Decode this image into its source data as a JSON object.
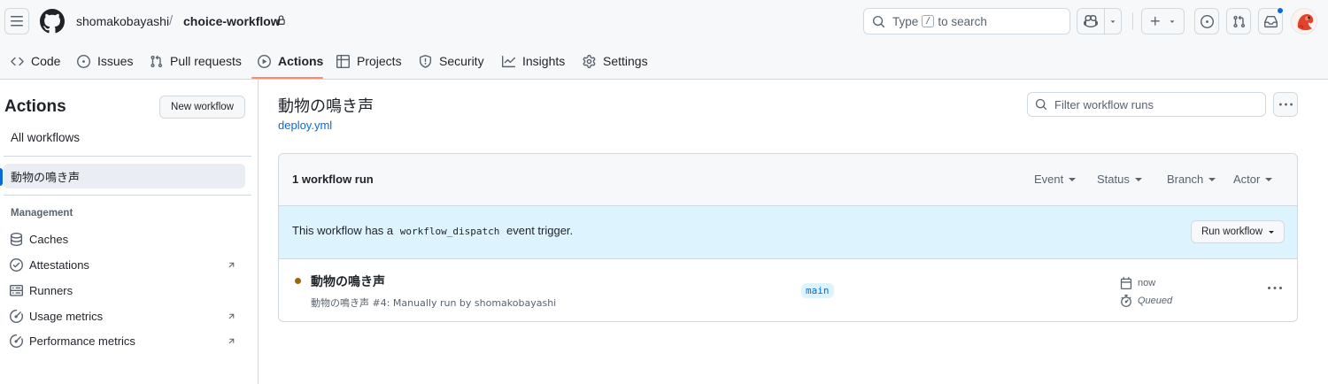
{
  "header": {
    "owner": "shomakobayashi",
    "separator": "/",
    "repo": "choice-workflow",
    "search": {
      "prefix": "Type",
      "key": "/",
      "suffix": "to search"
    }
  },
  "tabs": [
    {
      "label": "Code",
      "icon": "code-icon"
    },
    {
      "label": "Issues",
      "icon": "issue-opened-icon"
    },
    {
      "label": "Pull requests",
      "icon": "git-pull-request-icon"
    },
    {
      "label": "Actions",
      "icon": "play-icon",
      "active": true
    },
    {
      "label": "Projects",
      "icon": "table-icon"
    },
    {
      "label": "Security",
      "icon": "shield-icon"
    },
    {
      "label": "Insights",
      "icon": "graph-icon"
    },
    {
      "label": "Settings",
      "icon": "gear-icon"
    }
  ],
  "sidebar": {
    "title": "Actions",
    "new_workflow": "New workflow",
    "all_workflows": "All workflows",
    "active_workflow": "動物の鳴き声",
    "management_heading": "Management",
    "management_items": [
      {
        "label": "Caches",
        "icon": "database-icon",
        "external": false
      },
      {
        "label": "Attestations",
        "icon": "check-circle-icon",
        "external": true
      },
      {
        "label": "Runners",
        "icon": "server-icon",
        "external": false
      },
      {
        "label": "Usage metrics",
        "icon": "meter-icon",
        "external": true
      },
      {
        "label": "Performance metrics",
        "icon": "meter-icon",
        "external": true
      }
    ]
  },
  "main": {
    "workflow_title": "動物の鳴き声",
    "workflow_file": "deploy.yml",
    "filter_placeholder": "Filter workflow runs",
    "runs_count": "1 workflow run",
    "filters": [
      "Event",
      "Status",
      "Branch",
      "Actor"
    ],
    "dispatch": {
      "before": "This workflow has a",
      "code": "workflow_dispatch",
      "after": "event trigger.",
      "button": "Run workflow"
    },
    "run": {
      "title": "動物の鳴き声",
      "subtitle": "動物の鳴き声 #4: Manually run by shomakobayashi",
      "branch": "main",
      "time": "now",
      "status": "Queued",
      "status_color": "#9a6700"
    }
  },
  "colors": {
    "accent": "#0969da",
    "tab_underline": "#fd8c73",
    "dispatch_bg": "#ddf4ff"
  }
}
